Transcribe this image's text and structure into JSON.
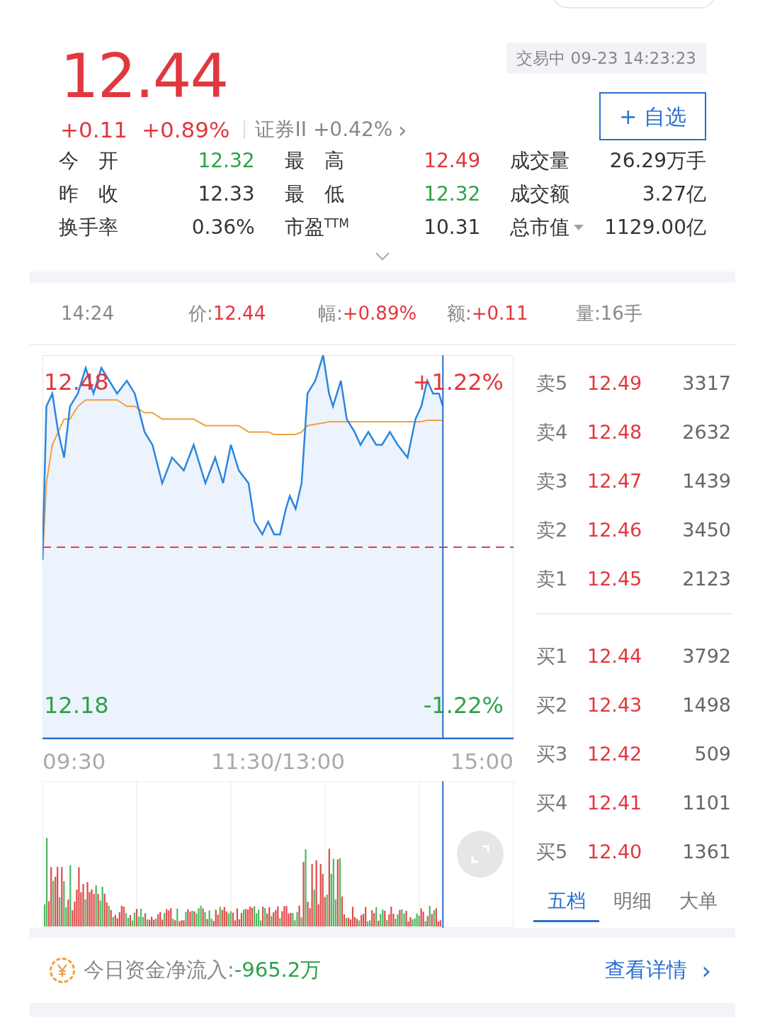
{
  "quote": {
    "price": "12.44",
    "change": "+0.11",
    "change_pct": "+0.89%",
    "sector": "证券II +0.42%",
    "sector_arrow": "›",
    "status": "交易中 09-23 14:23:23",
    "watch_button": "+ 自选"
  },
  "stats": [
    {
      "label": "今　开",
      "value": "12.32",
      "color": "#2ca24a"
    },
    {
      "label": "最　高",
      "value": "12.49",
      "color": "#e0383e"
    },
    {
      "label": "成交量",
      "value": "26.29万手",
      "color": "#333333"
    },
    {
      "label": "昨　收",
      "value": "12.33",
      "color": "#333333"
    },
    {
      "label": "最　低",
      "value": "12.32",
      "color": "#2ca24a"
    },
    {
      "label": "成交额",
      "value": "3.27亿",
      "color": "#333333"
    },
    {
      "label": "换手率",
      "value": "0.36%",
      "color": "#333333"
    },
    {
      "label": "市盈$^{TTM}$",
      "value": "10.31",
      "color": "#333333"
    },
    {
      "label": "总市值",
      "value": "1129.00亿",
      "color": "#333333",
      "dropdown": true
    }
  ],
  "info_bar": [
    {
      "label": "14:24"
    },
    {
      "label": "价:",
      "value": "12.44",
      "color": "#e0383e"
    },
    {
      "label": "幅:",
      "value": "+0.89%",
      "color": "#e0383e"
    },
    {
      "label": "额:",
      "value": "+0.11",
      "color": "#e0383e"
    },
    {
      "label": "量:",
      "value": "16手",
      "color": "#888888"
    }
  ],
  "price_chart": {
    "price_labels": [
      "12.48",
      "12.18"
    ],
    "percent_labels": [
      "+1.22%",
      "-1.22%"
    ],
    "time_labels": [
      "09:30",
      "11:30/13:00",
      "15:00"
    ]
  },
  "order_book": [
    {
      "kind": "sell",
      "label": "卖5",
      "price": "12.49",
      "volume": "3317"
    },
    {
      "kind": "sell",
      "label": "卖4",
      "price": "12.48",
      "volume": "2632"
    },
    {
      "kind": "sell",
      "label": "卖3",
      "price": "12.47",
      "volume": "1439"
    },
    {
      "kind": "sell",
      "label": "卖2",
      "price": "12.46",
      "volume": "3450"
    },
    {
      "kind": "sell",
      "label": "卖1",
      "price": "12.45",
      "volume": "2123"
    },
    {
      "kind": "buy",
      "label": "买1",
      "price": "12.44",
      "volume": "3792"
    },
    {
      "kind": "buy",
      "label": "买2",
      "price": "12.43",
      "volume": "1498"
    },
    {
      "kind": "buy",
      "label": "买3",
      "price": "12.42",
      "volume": "509"
    },
    {
      "kind": "buy",
      "label": "买4",
      "price": "12.41",
      "volume": "1101"
    },
    {
      "kind": "buy",
      "label": "买5",
      "price": "12.40",
      "volume": "1361"
    }
  ],
  "book_tabs": [
    {
      "label": "五档",
      "selected": true
    },
    {
      "label": "明细",
      "selected": false
    },
    {
      "label": "大单",
      "selected": false
    }
  ],
  "fund_flow": {
    "label": "今日资金净流入:",
    "value": "-965.2万",
    "color": "#2ca24a",
    "link": "查看详情",
    "link_arrow": "›"
  }
}
